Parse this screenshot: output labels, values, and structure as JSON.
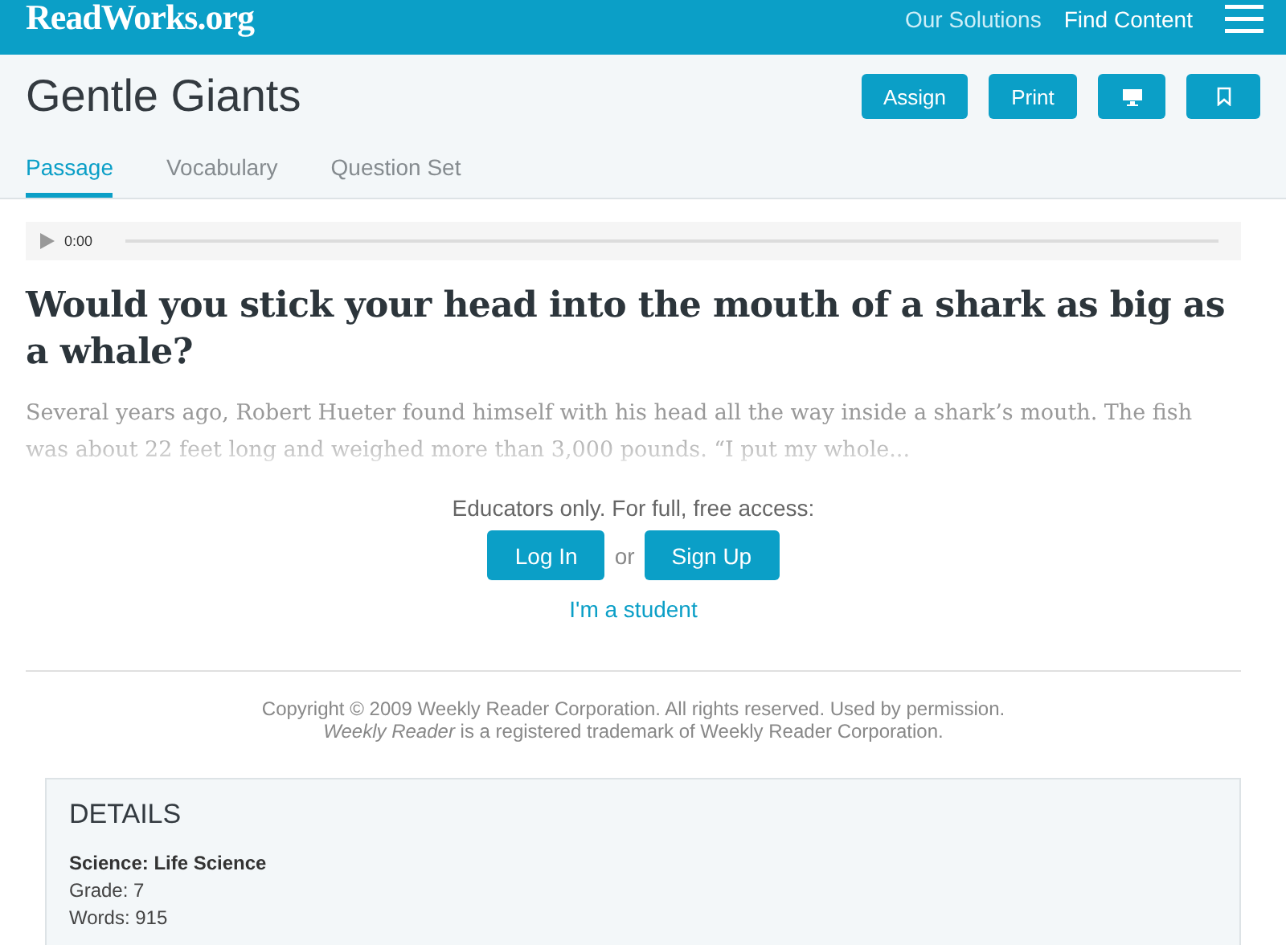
{
  "header": {
    "logo": "ReadWorks.org",
    "nav": [
      "Our Solutions",
      "Find Content"
    ]
  },
  "title_bar": {
    "title": "Gentle Giants",
    "buttons": [
      {
        "kind": "text",
        "label": "Assign"
      },
      {
        "kind": "text",
        "label": "Print"
      },
      {
        "kind": "monitor"
      },
      {
        "kind": "bookmark"
      }
    ]
  },
  "tabs": [
    {
      "label": "Passage",
      "selected": true
    },
    {
      "label": "Vocabulary",
      "selected": false
    },
    {
      "label": "Question Set",
      "selected": false
    }
  ],
  "audio_player": {
    "time": "0:00"
  },
  "article": {
    "heading": "Would you stick your head into the mouth of a shark as big as a whale?",
    "excerpt": "Several years ago, Robert Hueter found himself with his head all the way inside a shark’s mouth. The fish was about 22 feet long and weighed more than 3,000 pounds. “I put my whole..."
  },
  "access": {
    "prompt": "Educators only. For full, free access:",
    "login": "Log In",
    "or": "or",
    "signup": "Sign Up",
    "student_link": "I'm a student"
  },
  "copyright": [
    "Copyright © 2009 Weekly Reader Corporation. All rights reserved. Used by permission.",
    "*Weekly Reader* is a registered trademark of Weekly Reader Corporation."
  ],
  "details": {
    "heading": "DETAILS",
    "subject": "Science: Life Science",
    "lines": [
      "Grade: 7",
      "Words: 915"
    ]
  }
}
